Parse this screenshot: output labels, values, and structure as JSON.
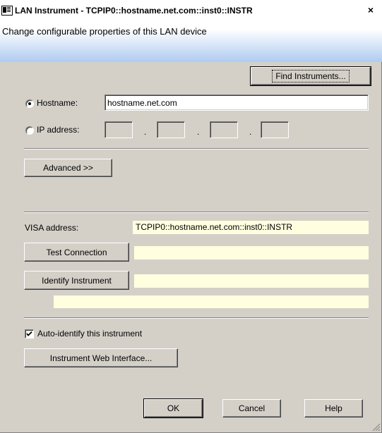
{
  "window": {
    "title": "LAN Instrument - TCPIP0::hostname.net.com::inst0::INSTR",
    "close_glyph": "×"
  },
  "header": {
    "description": "Change configurable properties of this LAN device"
  },
  "buttons": {
    "find_instruments": "Find Instruments...",
    "advanced": "Advanced >>",
    "test_connection": "Test Connection",
    "identify_instrument": "Identify Instrument",
    "web_interface": "Instrument Web Interface...",
    "ok": "OK",
    "cancel": "Cancel",
    "help": "Help"
  },
  "addressing": {
    "hostname_label": "Hostname:",
    "hostname_value": "hostname.net.com",
    "hostname_selected": true,
    "ip_label": "IP address:",
    "ip_octets": [
      "",
      "",
      "",
      ""
    ],
    "ip_separator": "."
  },
  "visa": {
    "label": "VISA address:",
    "value": "TCPIP0::hostname.net.com::inst0::INSTR",
    "test_result": "",
    "identify_result": "",
    "identify_detail": ""
  },
  "options": {
    "auto_identify_label": "Auto-identify this instrument",
    "auto_identify_checked": true
  },
  "icons": {
    "window": "window-icon",
    "close": "close-icon",
    "check": "check-icon",
    "resize": "resize-grip-icon"
  },
  "colors": {
    "dialog_bg": "#d4d0c8",
    "header_gradient_end": "#aecbf0",
    "readonly_bg": "#ffffe0"
  }
}
